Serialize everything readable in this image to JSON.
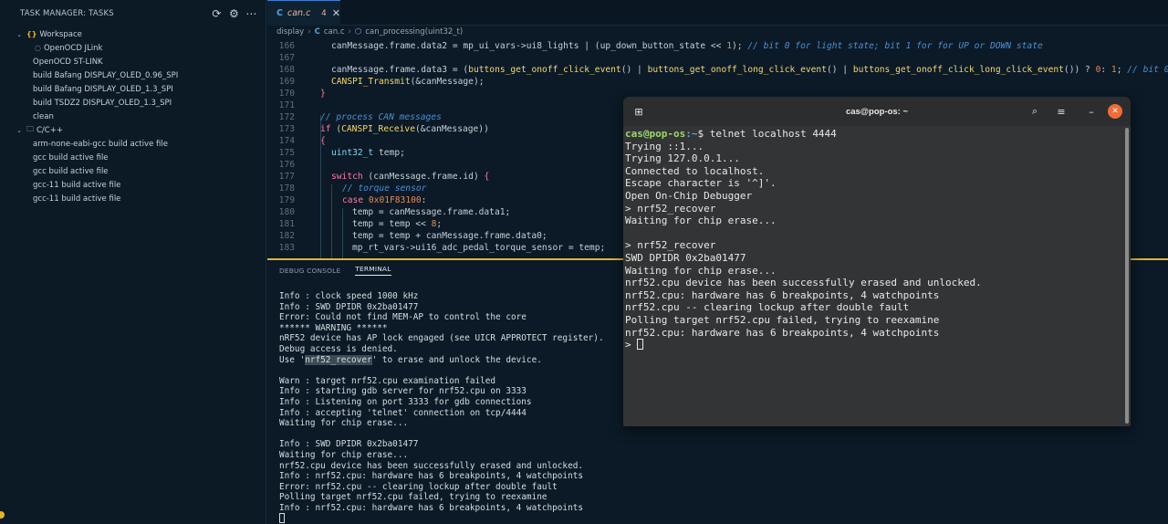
{
  "sidebar": {
    "header": "TASK MANAGER: TASKS",
    "actions": [
      "refresh-icon",
      "gear-icon",
      "more-icon"
    ],
    "workspace_label": "Workspace",
    "workspace_items": [
      "OpenOCD JLink",
      "OpenOCD ST-LINK",
      "build Bafang DISPLAY_OLED_0.96_SPI",
      "build Bafang DISPLAY_OLED_1.3_SPI",
      "build TSDZ2 DISPLAY_OLED_1.3_SPI",
      "clean"
    ],
    "cpp_label": "C/C++",
    "cpp_items": [
      "arm-none-eabi-gcc build active file",
      "gcc build active file",
      "gcc build active file",
      "gcc-11 build active file",
      "gcc-11 build active file"
    ]
  },
  "editor": {
    "tab": {
      "label": "can.c",
      "problems": "4"
    },
    "breadcrumb": [
      "display",
      "can.c",
      "can_processing(uint32_t)"
    ],
    "line_numbers": [
      "166",
      "167",
      "168",
      "169",
      "170",
      "171",
      "172",
      "173",
      "174",
      "175",
      "176",
      "177",
      "178",
      "179",
      "180",
      "181",
      "182",
      "183"
    ]
  },
  "panel": {
    "tabs": [
      "DEBUG CONSOLE",
      "TERMINAL"
    ],
    "active_tab": "TERMINAL",
    "lines": [
      "Info : clock speed 1000 kHz",
      "Info : SWD DPIDR 0x2ba01477",
      "Error: Could not find MEM-AP to control the core",
      "****** WARNING ******",
      "nRF52 device has AP lock engaged (see UICR APPROTECT register).",
      "Debug access is denied.",
      "Use '%%nrf52_recover%%' to erase and unlock the device.",
      "",
      "Warn : target nrf52.cpu examination failed",
      "Info : starting gdb server for nrf52.cpu on 3333",
      "Info : Listening on port 3333 for gdb connections",
      "Info : accepting 'telnet' connection on tcp/4444",
      "Waiting for chip erase...",
      "",
      "Info : SWD DPIDR 0x2ba01477",
      "Waiting for chip erase...",
      "nrf52.cpu device has been successfully erased and unlocked.",
      "Info : nrf52.cpu: hardware has 6 breakpoints, 4 watchpoints",
      "Error: nrf52.cpu -- clearing lockup after double fault",
      "Polling target nrf52.cpu failed, trying to reexamine",
      "Info : nrf52.cpu: hardware has 6 breakpoints, 4 watchpoints"
    ]
  },
  "gnome_terminal": {
    "title": "cas@pop-os: ~",
    "prompt_user": "cas@pop-os",
    "prompt_path": ":~",
    "command": "$ telnet localhost 4444",
    "lines": [
      "Trying ::1...",
      "Trying 127.0.0.1...",
      "Connected to localhost.",
      "Escape character is '^]'.",
      "Open On-Chip Debugger",
      "> nrf52_recover",
      "Waiting for chip erase...",
      "",
      "> nrf52_recover",
      "SWD DPIDR 0x2ba01477",
      "Waiting for chip erase...",
      "nrf52.cpu device has been successfully erased and unlocked.",
      "nrf52.cpu: hardware has 6 breakpoints, 4 watchpoints",
      "nrf52.cpu -- clearing lockup after double fault",
      "Polling target nrf52.cpu failed, trying to reexamine",
      "nrf52.cpu: hardware has 6 breakpoints, 4 watchpoints"
    ],
    "final_prompt": "> "
  },
  "colors": {
    "accent_yellow": "#e6b422",
    "terminal_close": "#f06b36"
  }
}
